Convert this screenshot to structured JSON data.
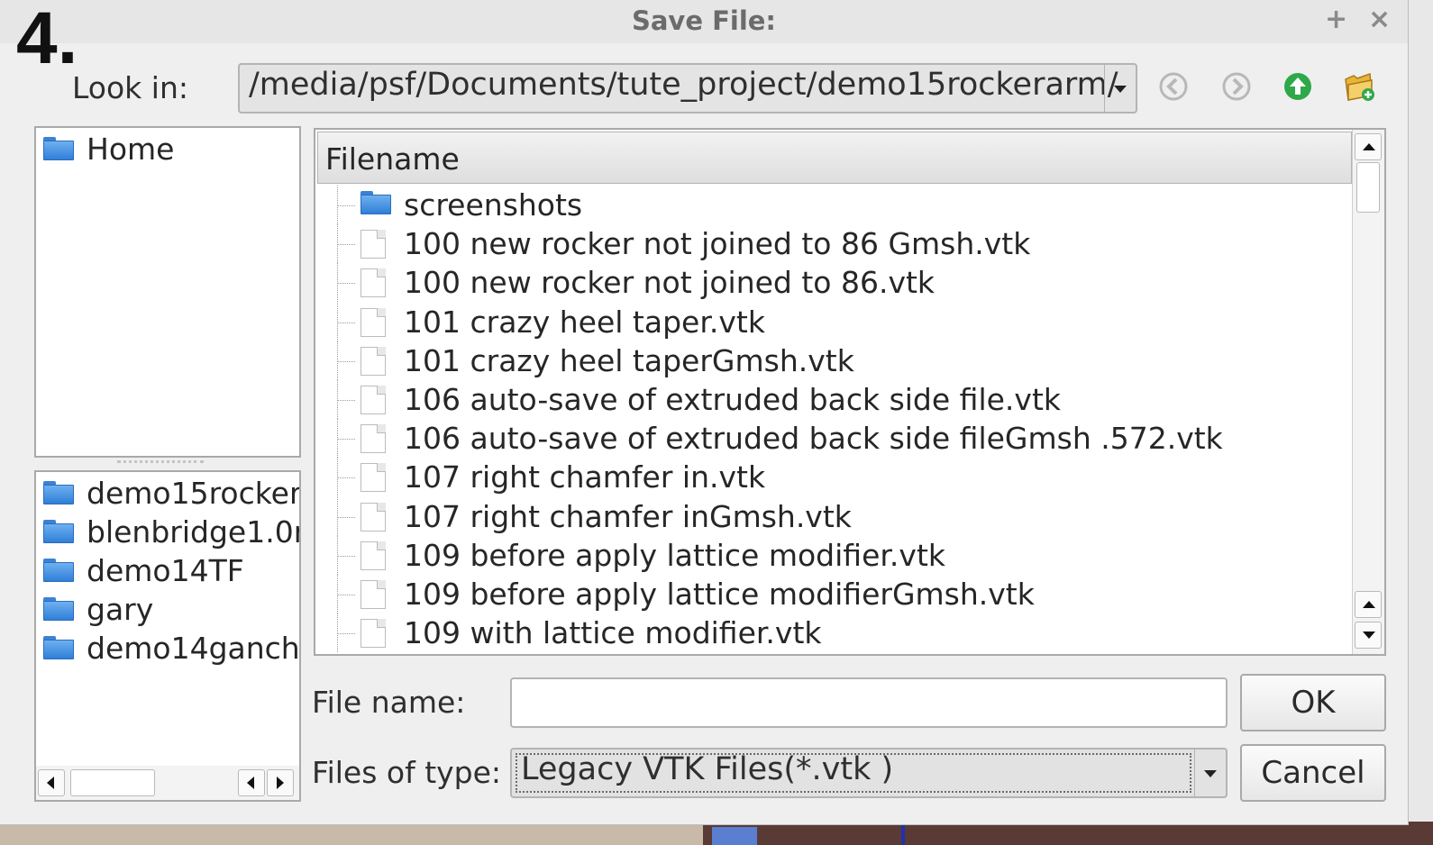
{
  "step_label": "4.",
  "window": {
    "title": "Save File:",
    "maximize_glyph": "+",
    "close_glyph": "×"
  },
  "look_in": {
    "label": "Look in:",
    "path": "/media/psf/Documents/tute_project/demo15rockerarm/"
  },
  "toolbar": {
    "icons": [
      "back-icon",
      "forward-icon",
      "parent-directory-icon",
      "new-folder-icon"
    ],
    "colors": {
      "nav": "#b8b8b8",
      "parent": "#2fa84a",
      "new_folder": "#e8b43a"
    }
  },
  "sidebar": {
    "places": [
      {
        "label": "Home",
        "icon": "folder-icon"
      }
    ],
    "recent": [
      {
        "label": "demo15rocker",
        "icon": "folder-icon"
      },
      {
        "label": "blenbridge1.0r",
        "icon": "folder-icon"
      },
      {
        "label": "demo14TF",
        "icon": "folder-icon"
      },
      {
        "label": "gary",
        "icon": "folder-icon"
      },
      {
        "label": "demo14ganch",
        "icon": "folder-icon"
      }
    ]
  },
  "file_list": {
    "column_header": "Filename",
    "rows": [
      {
        "name": "screenshots",
        "type": "folder"
      },
      {
        "name": "100 new rocker not joined to 86 Gmsh.vtk",
        "type": "file"
      },
      {
        "name": "100 new rocker not joined to 86.vtk",
        "type": "file"
      },
      {
        "name": "101 crazy heel taper.vtk",
        "type": "file"
      },
      {
        "name": "101 crazy heel taperGmsh.vtk",
        "type": "file"
      },
      {
        "name": "106 auto-save of extruded back side file.vtk",
        "type": "file"
      },
      {
        "name": "106 auto-save of extruded back side fileGmsh .572.vtk",
        "type": "file"
      },
      {
        "name": "107 right chamfer in.vtk",
        "type": "file"
      },
      {
        "name": "107 right chamfer inGmsh.vtk",
        "type": "file"
      },
      {
        "name": "109 before apply lattice modifier.vtk",
        "type": "file"
      },
      {
        "name": "109 before apply lattice modifierGmsh.vtk",
        "type": "file"
      },
      {
        "name": "109 with lattice modifier.vtk",
        "type": "file"
      }
    ]
  },
  "file_name": {
    "label": "File name:",
    "value": ""
  },
  "file_type": {
    "label": "Files of type:",
    "value": "Legacy VTK Files(*.vtk )"
  },
  "buttons": {
    "ok": "OK",
    "cancel": "Cancel"
  }
}
